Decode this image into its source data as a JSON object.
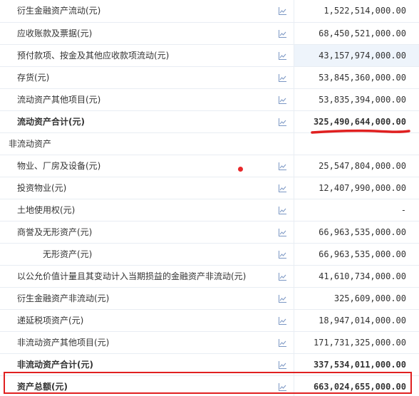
{
  "colors": {
    "annotation_red": "#e02020",
    "icon_blue": "#7b97c4",
    "row_border": "#e8edf3",
    "highlight_bg": "#eef4fb"
  },
  "icon": "line-chart-icon",
  "rows": [
    {
      "label": "衍生金融资产流动(元)",
      "value": "1,522,514,000.00"
    },
    {
      "label": "应收账款及票据(元)",
      "value": "68,450,521,000.00"
    },
    {
      "label": "预付款项、按金及其他应收款项流动(元)",
      "value": "43,157,974,000.00"
    },
    {
      "label": "存货(元)",
      "value": "53,845,360,000.00"
    },
    {
      "label": "流动资产其他项目(元)",
      "value": "53,835,394,000.00"
    },
    {
      "label": "流动资产合计(元)",
      "value": "325,490,644,000.00"
    },
    {
      "label": "非流动资产",
      "value": ""
    },
    {
      "label": "物业、厂房及设备(元)",
      "value": "25,547,804,000.00"
    },
    {
      "label": "投资物业(元)",
      "value": "12,407,990,000.00"
    },
    {
      "label": "土地使用权(元)",
      "value": "-"
    },
    {
      "label": "商誉及无形资产(元)",
      "value": "66,963,535,000.00"
    },
    {
      "label": "无形资产(元)",
      "value": "66,963,535,000.00"
    },
    {
      "label": "以公允价值计量且其变动计入当期损益的金融资产非流动(元)",
      "value": "41,610,734,000.00"
    },
    {
      "label": "衍生金融资产非流动(元)",
      "value": "325,609,000.00"
    },
    {
      "label": "递延税项资产(元)",
      "value": "18,947,014,000.00"
    },
    {
      "label": "非流动资产其他项目(元)",
      "value": "171,731,325,000.00"
    },
    {
      "label": "非流动资产合计(元)",
      "value": "337,534,011,000.00"
    },
    {
      "label": "资产总额(元)",
      "value": "663,024,655,000.00"
    }
  ]
}
